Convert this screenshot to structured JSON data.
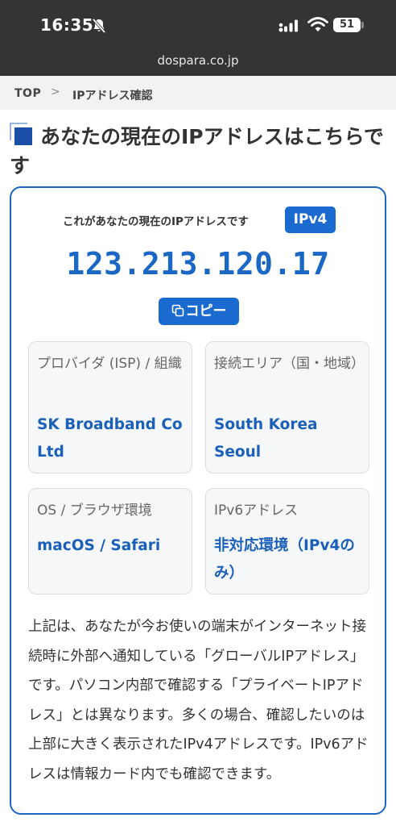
{
  "status_bar": {
    "time": "16:35",
    "battery": "51"
  },
  "browser": {
    "url": "dospara.co.jp"
  },
  "breadcrumb": {
    "top": "TOP",
    "separator": ">",
    "current": "IPアドレス確認"
  },
  "page": {
    "title": "あなたの現在のIPアドレスはこちらです"
  },
  "card": {
    "caption": "これがあなたの現在のIPアドレスです",
    "badge": "IPv4",
    "ip_address": "123.213.120.17",
    "copy_label": "コピー",
    "info": {
      "isp_label": "プロバイダ (ISP) / 組織",
      "isp_value": "SK Broadband Co Ltd",
      "area_label": "接続エリア（国・地域）",
      "area_value": "South Korea Seoul",
      "os_label": "OS / ブラウザ環境",
      "os_value": "macOS / Safari",
      "ipv6_label": "IPv6アドレス",
      "ipv6_value": "非対応環境（IPv4のみ）"
    },
    "description": "上記は、あなたが今お使いの端末がインターネット接続時に外部へ通知している「グローバルIPアドレス」です。パソコン内部で確認する「プライベートIPアドレス」とは異なります。多くの場合、確認したいのは上部に大きく表示されたIPv4アドレスです。IPv6アドレスは情報カード内でも確認できます。"
  },
  "colors": {
    "accent": "#1a6ad0",
    "status_bar_bg": "#333435",
    "title_square": "#1a4fa8"
  },
  "icons": [
    "bell-slash-icon",
    "signal-icon",
    "wifi-icon",
    "battery-icon",
    "chevron-right-icon",
    "square-bullet-icon",
    "copy-icon"
  ]
}
